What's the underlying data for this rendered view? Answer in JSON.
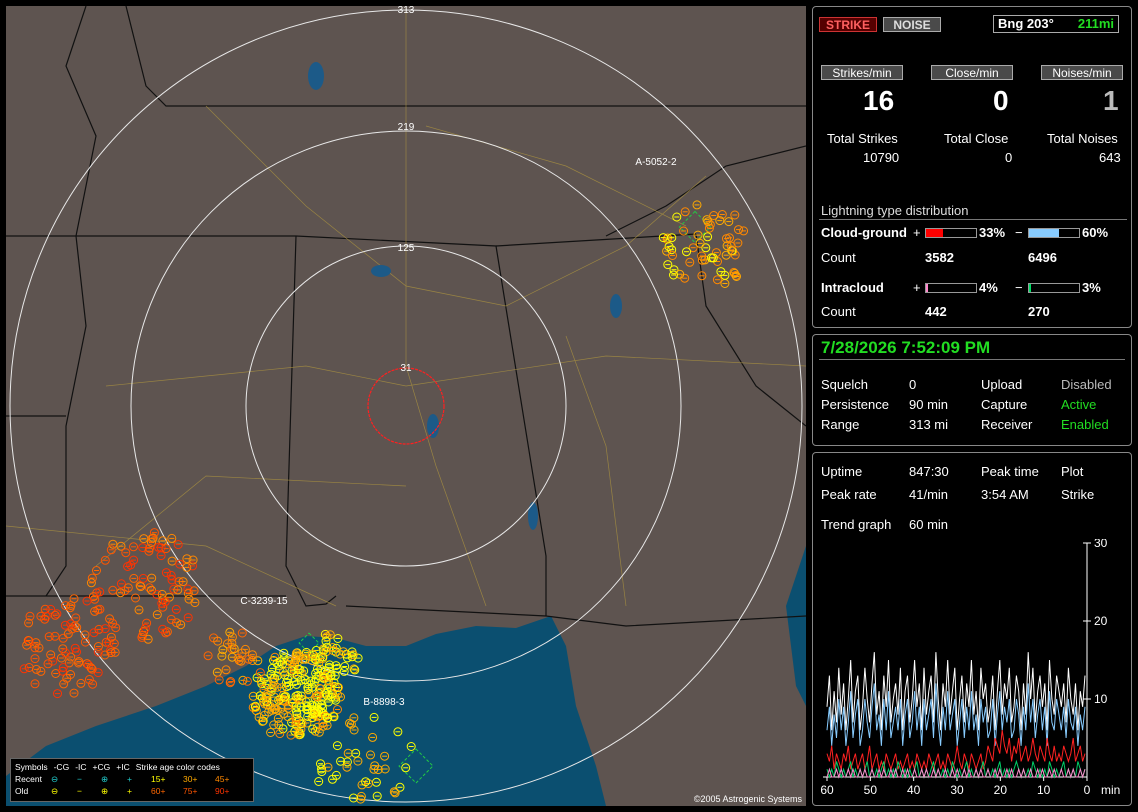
{
  "map": {
    "range_rings": [
      "31",
      "125",
      "219",
      "313"
    ],
    "labels": [
      "A-5052-2",
      "C-3239-15",
      "B-8898-3"
    ],
    "copyright": "©2005 Astrogenic Systems",
    "legend": {
      "symbols_label": "Symbols",
      "recent_label": "Recent",
      "old_label": "Old",
      "types": [
        "-CG",
        "-IC",
        "+CG",
        "+IC"
      ],
      "age_title": "Strike age color codes",
      "recent_ages": [
        "15+",
        "30+",
        "45+"
      ],
      "old_ages": [
        "60+",
        "75+",
        "90+"
      ],
      "age_colors": [
        "#ffff00",
        "#ffaa00",
        "#ff8800",
        "#ff6600",
        "#ff5500",
        "#ff3300"
      ]
    }
  },
  "status": {
    "strike_button": "STRIKE",
    "noise_button": "NOISE",
    "bearing": "Bng 203°",
    "distance": "211mi"
  },
  "rates": {
    "strikes_label": "Strikes/min",
    "close_label": "Close/min",
    "noises_label": "Noises/min",
    "strikes_value": "16",
    "close_value": "0",
    "noises_value": "1"
  },
  "totals": {
    "strikes_label": "Total Strikes",
    "close_label": "Total Close",
    "noises_label": "Total Noises",
    "strikes_value": "10790",
    "close_value": "0",
    "noises_value": "643"
  },
  "distribution": {
    "title": "Lightning type distribution",
    "cg_label": "Cloud-ground",
    "ic_label": "Intracloud",
    "count_label": "Count",
    "plus": "+",
    "minus": "−",
    "cg_pos_pct": "33%",
    "cg_neg_pct": "60%",
    "cg_pos_count": "3582",
    "cg_neg_count": "6496",
    "ic_pos_pct": "4%",
    "ic_neg_pct": "3%",
    "ic_pos_count": "442",
    "ic_neg_count": "270",
    "fractions": {
      "cg_pos": 0.33,
      "cg_neg": 0.6,
      "ic_pos": 0.04,
      "ic_neg": 0.03
    },
    "colors": {
      "cg_pos": "#ff0000",
      "cg_neg": "#88ccff",
      "ic_pos": "#ff88cc",
      "ic_neg": "#00dd66"
    }
  },
  "clock": {
    "datetime": "7/28/2026 7:52:09 PM"
  },
  "settings": {
    "squelch_label": "Squelch",
    "squelch_value": "0",
    "persistence_label": "Persistence",
    "persistence_value": "90 min",
    "range_label": "Range",
    "range_value": "313 mi",
    "upload_label": "Upload",
    "upload_value": "Disabled",
    "capture_label": "Capture",
    "capture_value": "Active",
    "receiver_label": "Receiver",
    "receiver_value": "Enabled"
  },
  "stats": {
    "uptime_label": "Uptime",
    "uptime_value": "847:30",
    "peak_time_label": "Peak time",
    "peak_time_value": "3:54 AM",
    "plot_label": "Plot",
    "plot_value": "Strike",
    "peak_rate_label": "Peak rate",
    "peak_rate_value": "41/min",
    "trend_label": "Trend graph",
    "trend_value": "60 min"
  },
  "chart_data": {
    "type": "line",
    "xlabel": "min",
    "x_ticks": [
      "60",
      "50",
      "40",
      "30",
      "20",
      "10",
      "0"
    ],
    "y_ticks": [
      "30",
      "20",
      "10"
    ],
    "xlim": [
      60,
      0
    ],
    "ylim": [
      0,
      30
    ],
    "series": [
      {
        "color": "#ffffff",
        "values": [
          9,
          13,
          6,
          11,
          7,
          14,
          8,
          12,
          6,
          10,
          15,
          7,
          11,
          13,
          6,
          9,
          14,
          10,
          7,
          12,
          16,
          8,
          11,
          6,
          13,
          9,
          15,
          7,
          10,
          12,
          8,
          14,
          6,
          11,
          13,
          7,
          10,
          15,
          9,
          12,
          6,
          14,
          8,
          11,
          13,
          7,
          16,
          10,
          6,
          12,
          9,
          15,
          8,
          11,
          14,
          6,
          10,
          13,
          7,
          12,
          9,
          15,
          8,
          11,
          6,
          14,
          10,
          12,
          7,
          9,
          13,
          6,
          11,
          15,
          8,
          12,
          10,
          14,
          7,
          9,
          13,
          11,
          6,
          12,
          8,
          16,
          10,
          14,
          7,
          11,
          13,
          9,
          12,
          6,
          15,
          10,
          8,
          13,
          11,
          9,
          12,
          7,
          14,
          10,
          8,
          12,
          6,
          11,
          9,
          13
        ]
      },
      {
        "color": "#88ccff",
        "values": [
          6,
          9,
          4,
          8,
          5,
          10,
          6,
          9,
          4,
          7,
          11,
          5,
          8,
          10,
          4,
          6,
          10,
          7,
          5,
          9,
          12,
          6,
          8,
          4,
          10,
          6,
          11,
          5,
          7,
          9,
          6,
          10,
          4,
          8,
          10,
          5,
          7,
          11,
          6,
          9,
          4,
          10,
          6,
          8,
          10,
          5,
          12,
          7,
          4,
          9,
          6,
          11,
          6,
          8,
          10,
          4,
          7,
          10,
          5,
          9,
          6,
          11,
          6,
          8,
          4,
          10,
          7,
          9,
          5,
          6,
          10,
          4,
          8,
          11,
          6,
          9,
          7,
          10,
          5,
          6,
          10,
          8,
          4,
          9,
          6,
          12,
          7,
          10,
          5,
          8,
          10,
          6,
          9,
          4,
          11,
          7,
          6,
          10,
          8,
          6,
          9,
          5,
          10,
          7,
          6,
          9,
          4,
          8,
          6,
          9
        ]
      },
      {
        "color": "#ff2222",
        "values": [
          3,
          2,
          4,
          1,
          3,
          2,
          1,
          3,
          2,
          4,
          1,
          2,
          3,
          1,
          2,
          3,
          1,
          2,
          4,
          1,
          2,
          3,
          1,
          2,
          1,
          3,
          2,
          1,
          2,
          3,
          1,
          2,
          1,
          2,
          3,
          1,
          2,
          1,
          3,
          2,
          1,
          2,
          1,
          3,
          2,
          1,
          2,
          3,
          1,
          2,
          1,
          3,
          2,
          1,
          2,
          4,
          2,
          1,
          3,
          2,
          1,
          3,
          2,
          1,
          2,
          3,
          1,
          2,
          4,
          3,
          2,
          5,
          4,
          3,
          6,
          4,
          3,
          5,
          2,
          4,
          3,
          5,
          2,
          3,
          4,
          2,
          3,
          5,
          3,
          2,
          4,
          3,
          2,
          5,
          3,
          2,
          4,
          2,
          3,
          2,
          4,
          3,
          2,
          3,
          5,
          2,
          3,
          4,
          2,
          3
        ]
      },
      {
        "color": "#00cc66",
        "values": [
          1,
          0,
          1,
          0,
          2,
          1,
          0,
          1,
          0,
          1,
          2,
          0,
          1,
          0,
          1,
          0,
          1,
          2,
          0,
          1,
          0,
          1,
          0,
          1,
          2,
          0,
          1,
          0,
          1,
          0,
          2,
          1,
          0,
          1,
          0,
          1,
          0,
          1,
          2,
          0,
          1,
          0,
          1,
          0,
          1,
          2,
          0,
          1,
          0,
          1,
          0,
          1,
          0,
          2,
          1,
          0,
          1,
          0,
          1,
          2,
          0,
          1,
          0,
          1,
          0,
          1,
          2,
          0,
          1,
          0,
          1,
          0,
          1,
          2,
          0,
          1,
          0,
          1,
          0,
          1,
          2,
          1,
          0,
          1,
          0,
          1,
          0,
          2,
          1,
          0,
          1,
          0,
          1,
          0,
          2,
          1,
          0,
          1,
          0,
          1,
          2,
          0,
          1,
          0,
          1,
          0,
          2,
          1,
          0,
          1
        ]
      },
      {
        "color": "#ff88cc",
        "values": [
          0,
          1,
          0,
          0,
          1,
          0,
          1,
          0,
          0,
          1,
          0,
          1,
          0,
          0,
          1,
          0,
          1,
          0,
          0,
          1,
          0,
          0,
          1,
          0,
          1,
          0,
          0,
          1,
          0,
          1,
          0,
          0,
          1,
          0,
          1,
          0,
          0,
          1,
          0,
          0,
          1,
          0,
          1,
          0,
          0,
          1,
          0,
          1,
          0,
          0,
          1,
          0,
          0,
          1,
          0,
          1,
          0,
          0,
          1,
          0,
          1,
          0,
          0,
          1,
          0,
          1,
          0,
          0,
          1,
          0,
          0,
          1,
          0,
          1,
          0,
          0,
          1,
          0,
          1,
          0,
          0,
          1,
          0,
          1,
          0,
          0,
          1,
          0,
          0,
          1,
          0,
          1,
          0,
          0,
          1,
          0,
          1,
          0,
          0,
          1,
          0,
          0,
          1,
          0,
          1,
          0,
          0,
          1,
          0,
          1
        ]
      }
    ]
  }
}
